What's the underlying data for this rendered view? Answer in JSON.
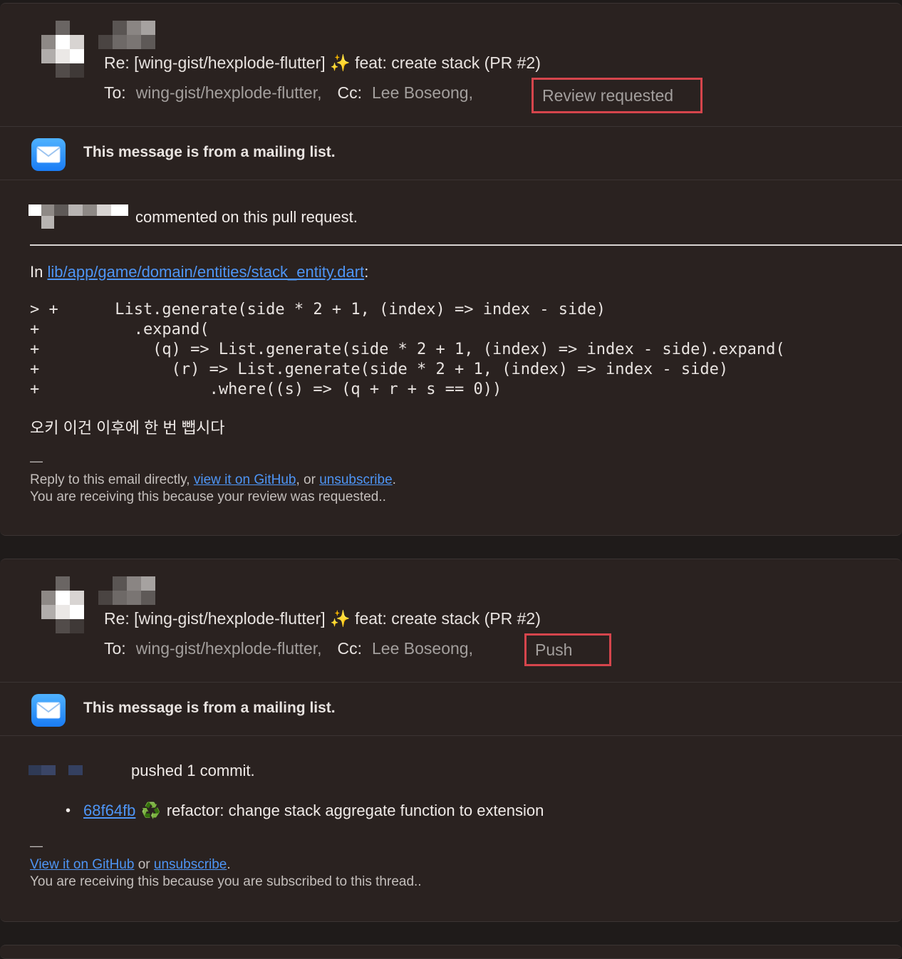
{
  "emails": [
    {
      "subject_prefix": "Re: [wing-gist/hexplode-flutter]",
      "subject_emoji": "✨",
      "subject_rest": "feat: create stack (PR #2)",
      "to_label": "To:",
      "to_value": "wing-gist/hexplode-flutter,",
      "cc_label": "Cc:",
      "cc_value": "Lee Boseong,",
      "reason": "Review requested",
      "mailing_notice": "This message is from a mailing list.",
      "comment_text": "commented on this pull request.",
      "in_prefix": "In",
      "file_link": "lib/app/game/domain/entities/stack_entity.dart",
      "in_suffix": ":",
      "code_lines": [
        "> +      List.generate(side * 2 + 1, (index) => index - side)",
        "+          .expand(",
        "+            (q) => List.generate(side * 2 + 1, (index) => index - side).expand(",
        "+              (r) => List.generate(side * 2 + 1, (index) => index - side)",
        "+                  .where((s) => (q + r + s == 0))"
      ],
      "reply_text": "오키 이건 이후에 한 번 뺍시다",
      "dash": "—",
      "footer_reply_prefix": "Reply to this email directly,",
      "footer_view_link": "view it on GitHub",
      "footer_or": ", or",
      "footer_unsub_link": "unsubscribe",
      "footer_period": ".",
      "footer_reason": "You are receiving this because your review was requested.."
    },
    {
      "subject_prefix": "Re: [wing-gist/hexplode-flutter]",
      "subject_emoji": "✨",
      "subject_rest": "feat: create stack (PR #2)",
      "to_label": "To:",
      "to_value": "wing-gist/hexplode-flutter,",
      "cc_label": "Cc:",
      "cc_value": "Lee Boseong,",
      "reason": "Push",
      "mailing_notice": "This message is from a mailing list.",
      "push_text": "pushed 1 commit.",
      "commit_hash": "68f64fb",
      "commit_emoji": "♻️",
      "commit_message": "refactor: change stack aggregate function to extension",
      "dash": "—",
      "footer_view_link": "View it on GitHub",
      "footer_or": "or",
      "footer_unsub_link": "unsubscribe",
      "footer_period": ".",
      "footer_reason": "You are receiving this because you are subscribed to this thread.."
    }
  ],
  "colors": {
    "background": "#2a2220",
    "link": "#4e95f5",
    "highlight_border": "#d5454c",
    "muted_text": "#a39f9d"
  }
}
